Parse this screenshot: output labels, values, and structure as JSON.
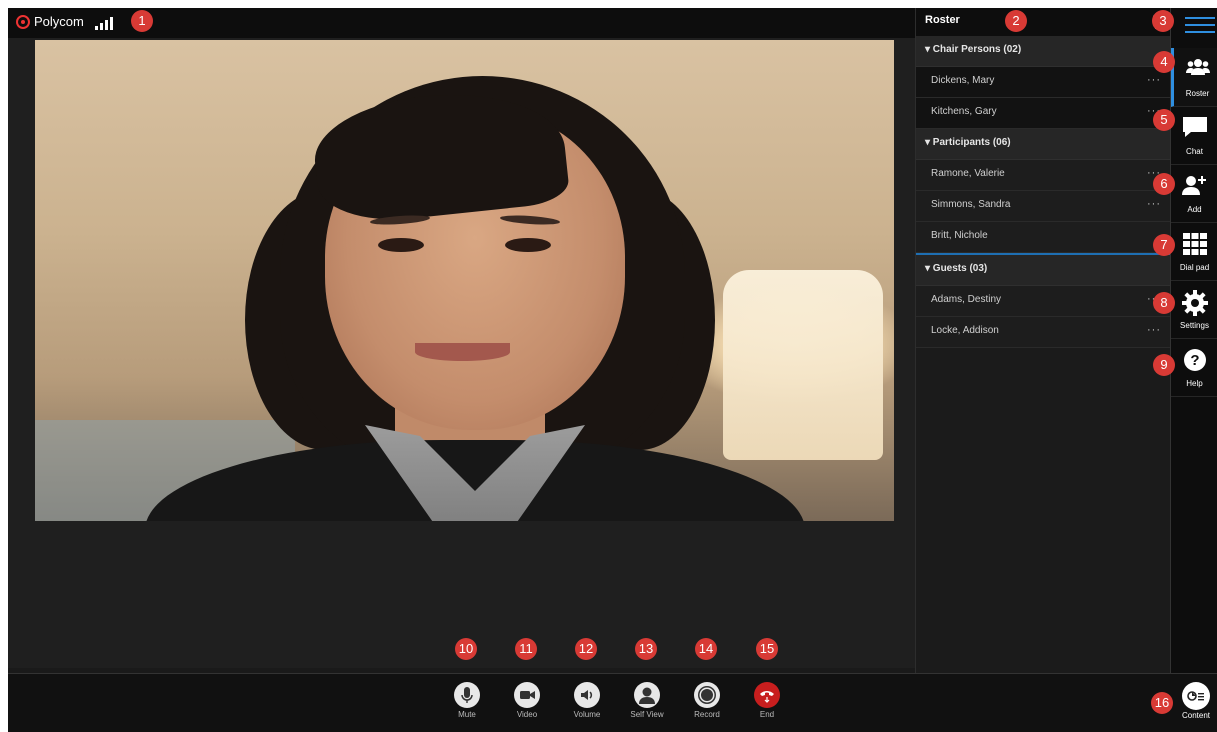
{
  "topbar": {
    "brand": "Polycom"
  },
  "roster_panel": {
    "title": "Roster",
    "sections": [
      {
        "label": "▾ Chair Persons (02)",
        "people": [
          "Dickens, Mary",
          "Kitchens, Gary"
        ]
      },
      {
        "label": "▾ Participants (06)",
        "people": [
          "Ramone, Valerie",
          "Simmons, Sandra",
          "Britt, Nichole"
        ]
      },
      {
        "label": "▾ Guests (03)",
        "people": [
          "Adams, Destiny",
          "Locke, Addison"
        ]
      }
    ],
    "more": "···"
  },
  "sidenav": {
    "items": [
      {
        "label": "Roster",
        "icon": "roster-icon"
      },
      {
        "label": "Chat",
        "icon": "chat-icon"
      },
      {
        "label": "Add",
        "icon": "add-person-icon"
      },
      {
        "label": "Dial pad",
        "icon": "dialpad-icon"
      },
      {
        "label": "Settings",
        "icon": "gear-icon"
      },
      {
        "label": "Help",
        "icon": "help-icon"
      }
    ]
  },
  "controls": {
    "mute": "Mute",
    "video": "Video",
    "volume": "Volume",
    "self_view": "Self View",
    "record": "Record",
    "end": "End",
    "content": "Content"
  },
  "badges": [
    "1",
    "2",
    "3",
    "4",
    "5",
    "6",
    "7",
    "8",
    "9",
    "10",
    "11",
    "12",
    "13",
    "14",
    "15",
    "16"
  ],
  "colors": {
    "accent": "#2f8fe0",
    "badge": "#d83a35",
    "end": "#c81e1e"
  }
}
